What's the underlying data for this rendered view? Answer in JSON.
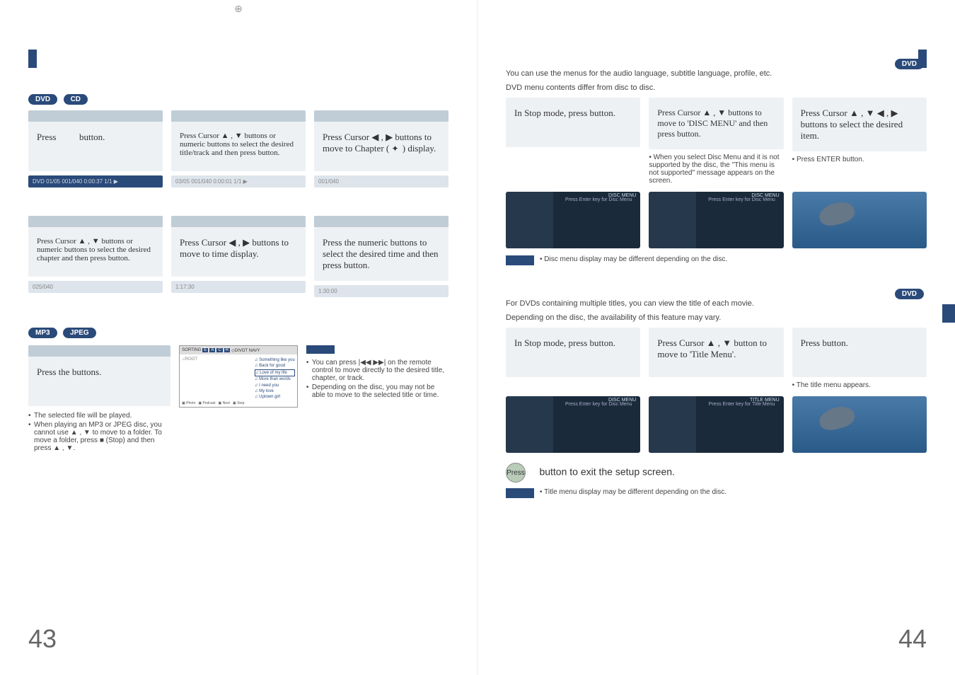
{
  "reg_mark_top": "⊕",
  "left": {
    "badges": [
      "DVD",
      "CD"
    ],
    "row1": {
      "c1": {
        "text_a": "Press",
        "text_b": "button."
      },
      "c2": "Press Cursor ▲ , ▼ buttons or numeric buttons to select the desired title/track and then press            button.",
      "c3_a": "Press Cursor ◀ , ▶ buttons to move to Chapter (",
      "c3_b": ") display."
    },
    "status1": {
      "c1": "DVD   01/05   001/040   0:00:37   1/1 ▶",
      "c2": "03/05   001/040   0:00:01   1/1 ▶",
      "c3": "001/040"
    },
    "row2": {
      "c1": "Press Cursor ▲ , ▼ buttons or numeric buttons to select the desired chapter and then press              button.",
      "c2": "Press Cursor ◀ , ▶ buttons to move to time display.",
      "c3": "Press the numeric buttons to select the desired time and then press              button."
    },
    "status2": {
      "c1": "025/040",
      "c2": "1:17:30",
      "c3": "1:30:00"
    },
    "mp3_badges": [
      "MP3",
      "JPEG"
    ],
    "mp3_box": "Press the                 buttons.",
    "mp3_bullets": [
      "The selected file will be played.",
      "When playing an MP3 or JPEG disc, you cannot use ▲ , ▼ to move to a folder. To move a folder, press ■ (Stop) and then press ▲ , ▼."
    ],
    "mp3_screen": {
      "topbar": [
        "SORTING",
        "E",
        "A",
        "C",
        "R",
        "◇DIVOT NAVY"
      ],
      "left": "♫ROOT",
      "list": [
        "♫ Something like you",
        "♫ Back for good",
        "♫ Love of my life",
        "♫ More than words",
        "♫ I need you",
        "♫ My love",
        "♫ Uptown girl"
      ],
      "bottom": [
        "▣ Photo",
        "▣ Podcast",
        "▣ Next",
        "▣ Stop"
      ]
    },
    "note_title": "",
    "note_bullets": [
      "You can press |◀◀ ▶▶| on the remote control to move directly to the desired title, chapter, or track.",
      "Depending on the disc, you may not be able to move to the selected title or time."
    ],
    "page_num": "43"
  },
  "right": {
    "top_badge": "DVD",
    "intro": [
      "You can use the menus for the audio language, subtitle language, profile, etc.",
      "DVD menu contents differ from disc to disc."
    ],
    "disc_row": {
      "c1": "In Stop mode, press              button.",
      "c2": "Press Cursor ▲ , ▼ buttons to move to 'DISC MENU' and then press            button.",
      "c3": "Press Cursor ▲ , ▼ ◀ , ▶ buttons to select the desired item.",
      "sub2": "When you select Disc Menu and it is not supported by the disc, the \"This menu is not supported\" message appears on the screen.",
      "sub3": "Press ENTER button."
    },
    "screen_label1": {
      "top": "DISC MENU",
      "main": "Press Enter key for Disc Menu"
    },
    "note1": "Disc menu display may be different depending on the disc.",
    "mid_badge": "DVD",
    "title_intro": [
      "For DVDs containing multiple titles, you can view the title of each movie.",
      "Depending on the disc, the availability of this feature may vary."
    ],
    "title_row": {
      "c1": "In Stop mode, press              button.",
      "c2": "Press Cursor ▲ , ▼ button to move to 'Title Menu'.",
      "c3": "Press              button.",
      "sub3": "The title menu appears."
    },
    "screen_label2": {
      "top": "TITLE MENU",
      "main": "Press Enter key for Title Menu"
    },
    "screen_label2b": {
      "top": "DISC MENU",
      "main": "Press Enter key for Disc Menu"
    },
    "exit_row": {
      "a": "Press",
      "b": "button to exit the setup screen."
    },
    "note2": "Title menu display may be different depending on the disc.",
    "page_num": "44"
  }
}
